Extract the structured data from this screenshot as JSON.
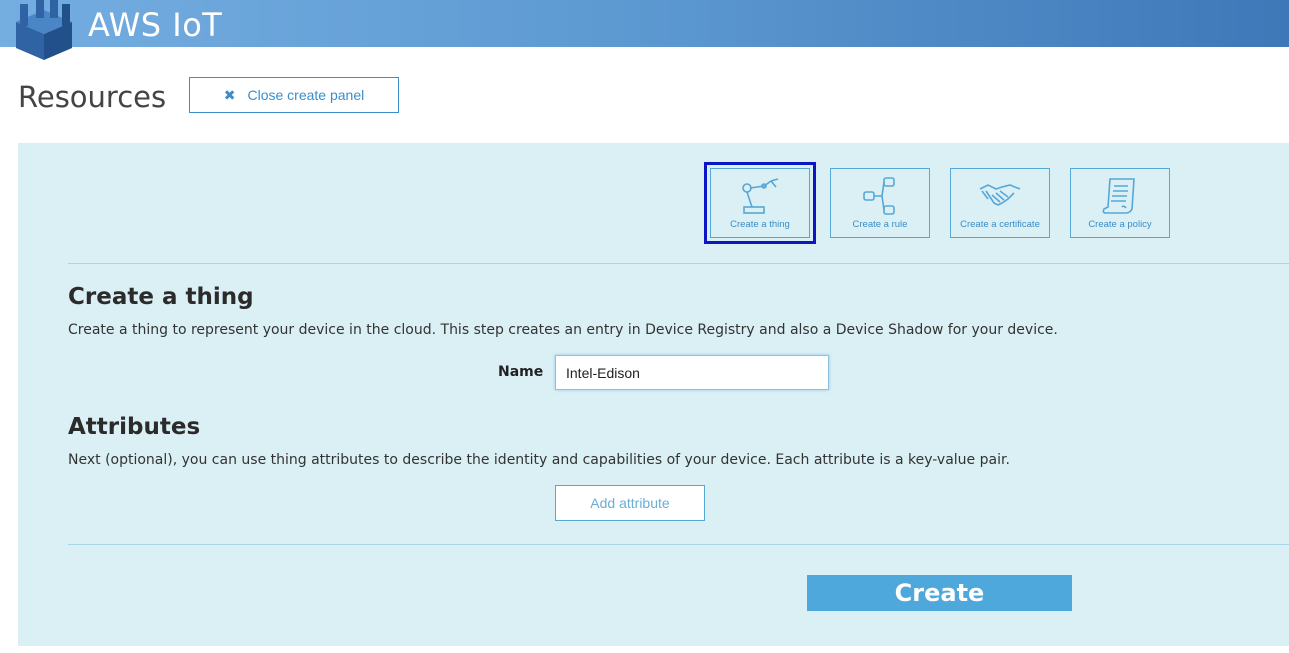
{
  "header": {
    "app_title": "AWS IoT",
    "logo_icon": "aws-cube-logo"
  },
  "page": {
    "title": "Resources",
    "close_panel_label": "Close create panel",
    "close_icon": "close-icon"
  },
  "tiles": [
    {
      "label": "Create a thing",
      "icon": "robot-arm-icon",
      "selected": true
    },
    {
      "label": "Create a rule",
      "icon": "rule-flow-icon",
      "selected": false
    },
    {
      "label": "Create a certificate",
      "icon": "handshake-icon",
      "selected": false
    },
    {
      "label": "Create a policy",
      "icon": "policy-document-icon",
      "selected": false
    }
  ],
  "form": {
    "heading": "Create a thing",
    "description": "Create a thing to represent your device in the cloud. This step creates an entry in Device Registry and also a Device Shadow for your device.",
    "name_label": "Name",
    "name_value": "Intel-Edison",
    "attributes_heading": "Attributes",
    "attributes_description": "Next (optional), you can use thing attributes to describe the identity and capabilities of your device. Each attribute is a key-value pair.",
    "add_attribute_label": "Add attribute",
    "create_label": "Create"
  },
  "colors": {
    "header_gradient_start": "#74ade0",
    "header_gradient_end": "#3f78b8",
    "panel_bg": "#daf0f5",
    "accent": "#3a8ec9",
    "create_button": "#4fa8dc",
    "selected_outline": "#0b16c4"
  }
}
